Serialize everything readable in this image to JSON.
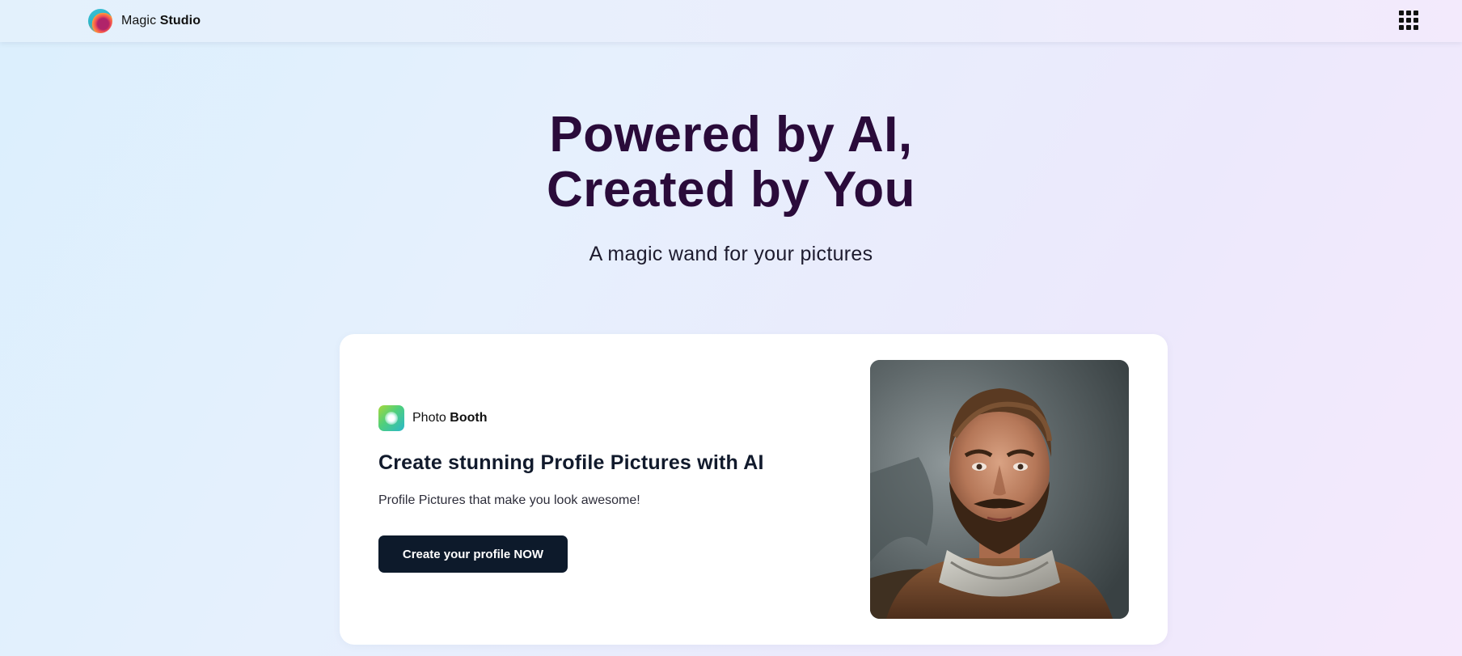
{
  "header": {
    "brand_prefix": "Magic",
    "brand_suffix": "Studio",
    "icons": {
      "logo": "magic-studio-logo",
      "apps": "apps-grid-icon"
    }
  },
  "hero": {
    "title_line1": "Powered by AI,",
    "title_line2": "Created by You",
    "subtitle": "A magic wand for your pictures"
  },
  "card": {
    "app_prefix": "Photo",
    "app_suffix": "Booth",
    "title": "Create stunning Profile Pictures with AI",
    "description": "Profile Pictures that make you look awesome!",
    "cta_label": "Create your profile NOW",
    "image_subject": "AI-generated portrait of a bearded man wearing a scarf"
  },
  "colors": {
    "title": "#2a0b3a",
    "cta_bg": "#0d1a2b",
    "card_bg": "#ffffff"
  }
}
